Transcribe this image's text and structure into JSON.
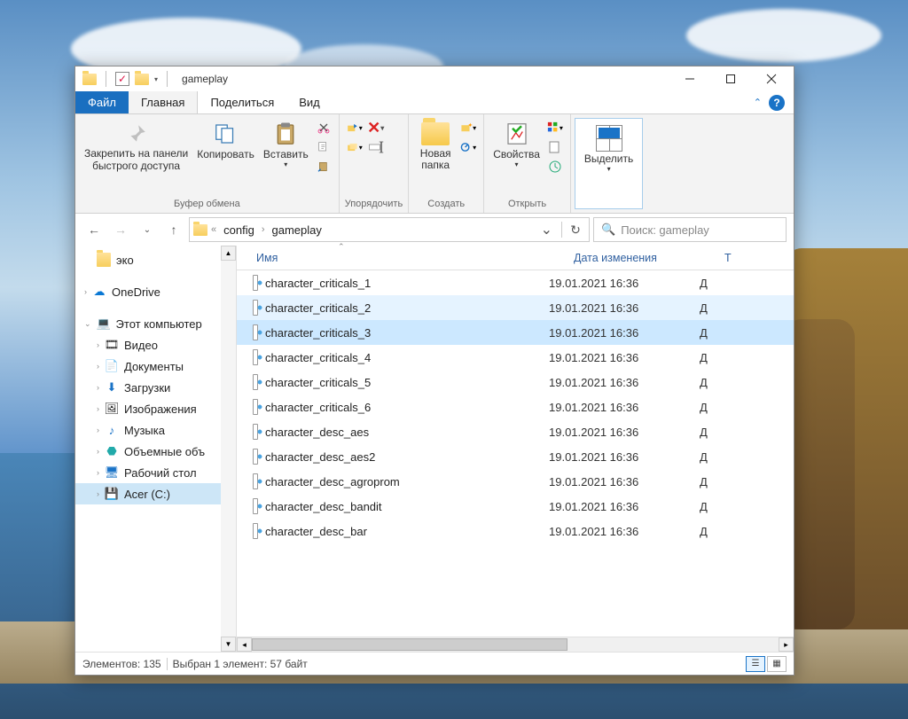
{
  "titlebar": {
    "title": "gameplay"
  },
  "tabs": {
    "file": "Файл",
    "home": "Главная",
    "share": "Поделиться",
    "view": "Вид"
  },
  "ribbon": {
    "pin": "Закрепить на панели\nбыстрого доступа",
    "copy": "Копировать",
    "paste": "Вставить",
    "clipboard_label": "Буфер обмена",
    "organize_label": "Упорядочить",
    "new_folder": "Новая\nпапка",
    "create_label": "Создать",
    "properties": "Свойства",
    "open_label": "Открыть",
    "select": "Выделить"
  },
  "nav": {
    "path1": "config",
    "path2": "gameplay",
    "search_placeholder": "Поиск: gameplay"
  },
  "sidebar": {
    "eco": "эко",
    "onedrive": "OneDrive",
    "thispc": "Этот компьютер",
    "video": "Видео",
    "documents": "Документы",
    "downloads": "Загрузки",
    "pictures": "Изображения",
    "music": "Музыка",
    "objects3d": "Объемные объ",
    "desktop": "Рабочий стол",
    "acer": "Acer (C:)"
  },
  "columns": {
    "name": "Имя",
    "date": "Дата изменения",
    "type": "Т"
  },
  "files": [
    {
      "name": "character_criticals_1",
      "date": "19.01.2021 16:36",
      "type": "Д",
      "sel": ""
    },
    {
      "name": "character_criticals_2",
      "date": "19.01.2021 16:36",
      "type": "Д",
      "sel": "hover"
    },
    {
      "name": "character_criticals_3",
      "date": "19.01.2021 16:36",
      "type": "Д",
      "sel": "selected"
    },
    {
      "name": "character_criticals_4",
      "date": "19.01.2021 16:36",
      "type": "Д",
      "sel": ""
    },
    {
      "name": "character_criticals_5",
      "date": "19.01.2021 16:36",
      "type": "Д",
      "sel": ""
    },
    {
      "name": "character_criticals_6",
      "date": "19.01.2021 16:36",
      "type": "Д",
      "sel": ""
    },
    {
      "name": "character_desc_aes",
      "date": "19.01.2021 16:36",
      "type": "Д",
      "sel": ""
    },
    {
      "name": "character_desc_aes2",
      "date": "19.01.2021 16:36",
      "type": "Д",
      "sel": ""
    },
    {
      "name": "character_desc_agroprom",
      "date": "19.01.2021 16:36",
      "type": "Д",
      "sel": ""
    },
    {
      "name": "character_desc_bandit",
      "date": "19.01.2021 16:36",
      "type": "Д",
      "sel": ""
    },
    {
      "name": "character_desc_bar",
      "date": "19.01.2021 16:36",
      "type": "Д",
      "sel": ""
    }
  ],
  "status": {
    "count": "Элементов: 135",
    "selection": "Выбран 1 элемент: 57 байт"
  }
}
